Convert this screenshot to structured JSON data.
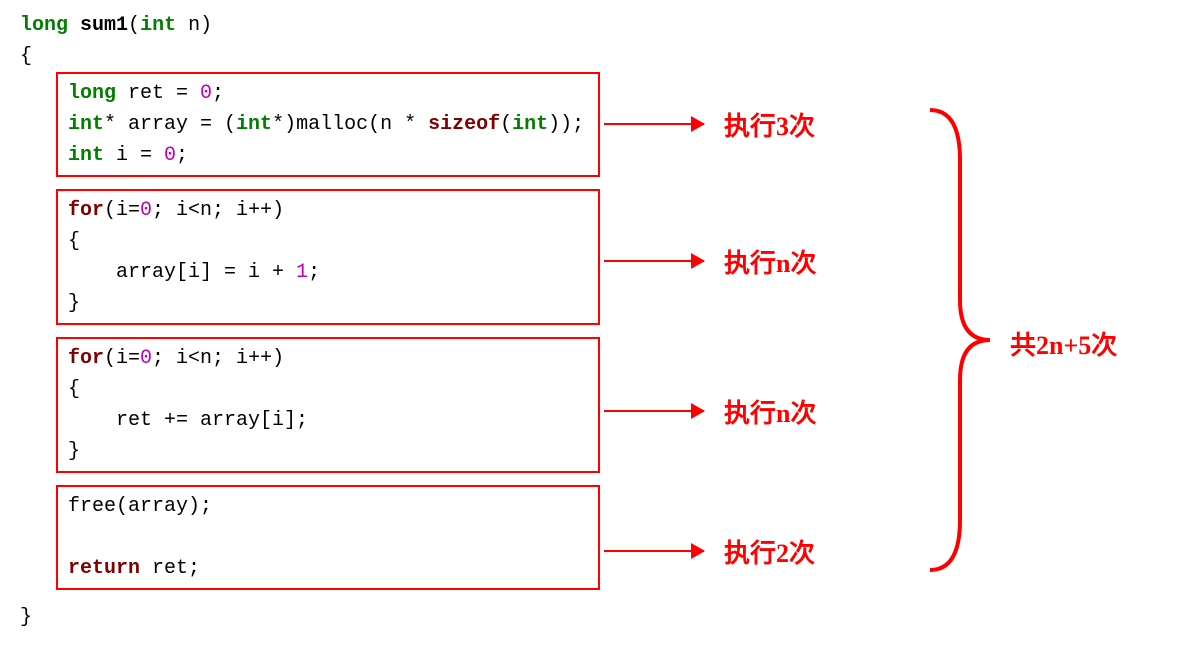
{
  "signature": {
    "ret_type": "long",
    "name": "sum1",
    "param_type": "int",
    "param_name": "n"
  },
  "block1": {
    "line1": {
      "kw": "long",
      "rest": " ret = ",
      "num": "0",
      "end": ";"
    },
    "line2": {
      "kw1": "int",
      "ptr": "* array = (",
      "kw2": "int",
      "mid": "*)malloc(n * ",
      "kw3": "sizeof",
      "par": "(",
      "kw4": "int",
      "end": "));"
    },
    "line3": {
      "kw": "int",
      "rest": " i = ",
      "num": "0",
      "end": ";"
    }
  },
  "block2": {
    "line1": {
      "kw": "for",
      "a": "(i=",
      "num": "0",
      "b": "; i<n; i++)"
    },
    "line2": "{",
    "line3": "    array[i] = i + ",
    "line3_one": "1",
    "line3_end": ";",
    "line4": "}"
  },
  "block3": {
    "line1": {
      "kw": "for",
      "a": "(i=",
      "num": "0",
      "b": "; i<n; i++)"
    },
    "line2": "{",
    "line3": "    ret += array[i];",
    "line4": "}"
  },
  "block4": {
    "line1": "free(array);",
    "line2": "",
    "line3": {
      "kw": "return",
      "rest": " ret;"
    }
  },
  "close_brace": "}",
  "open_brace": "{",
  "annotations": {
    "a1": "执行3次",
    "a2": "执行n次",
    "a3": "执行n次",
    "a4": "执行2次",
    "total": "共2n+5次"
  }
}
